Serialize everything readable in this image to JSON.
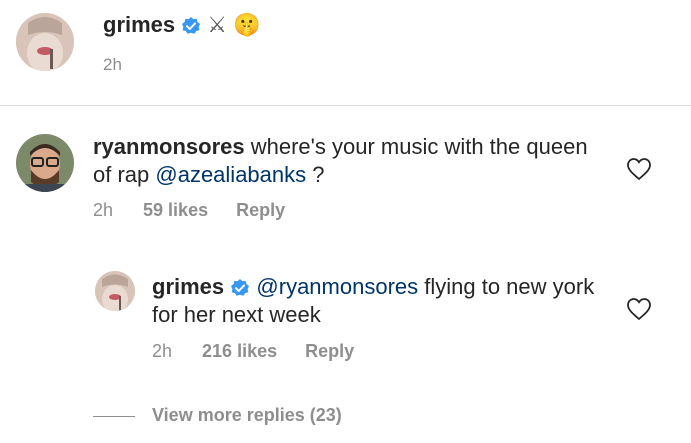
{
  "post": {
    "username": "grimes",
    "emoji_swords": "⚔",
    "emoji_shush": "🤫",
    "time": "2h"
  },
  "comments": [
    {
      "username": "ryanmonsores",
      "text_before": " where's your music with the queen of rap ",
      "mention": "@azealiabanks",
      "text_after": " ?",
      "time": "2h",
      "likes": "59 likes",
      "reply_label": "Reply"
    }
  ],
  "replies": [
    {
      "username": "grimes",
      "mention": "@ryanmonsores",
      "text_after": " flying to new york for her next week",
      "time": "2h",
      "likes": "216 likes",
      "reply_label": "Reply"
    }
  ],
  "view_more": "View more replies (23)",
  "colors": {
    "verified_blue": "#3897f0",
    "muted_text": "#8e8e8e",
    "mention": "#003569"
  }
}
